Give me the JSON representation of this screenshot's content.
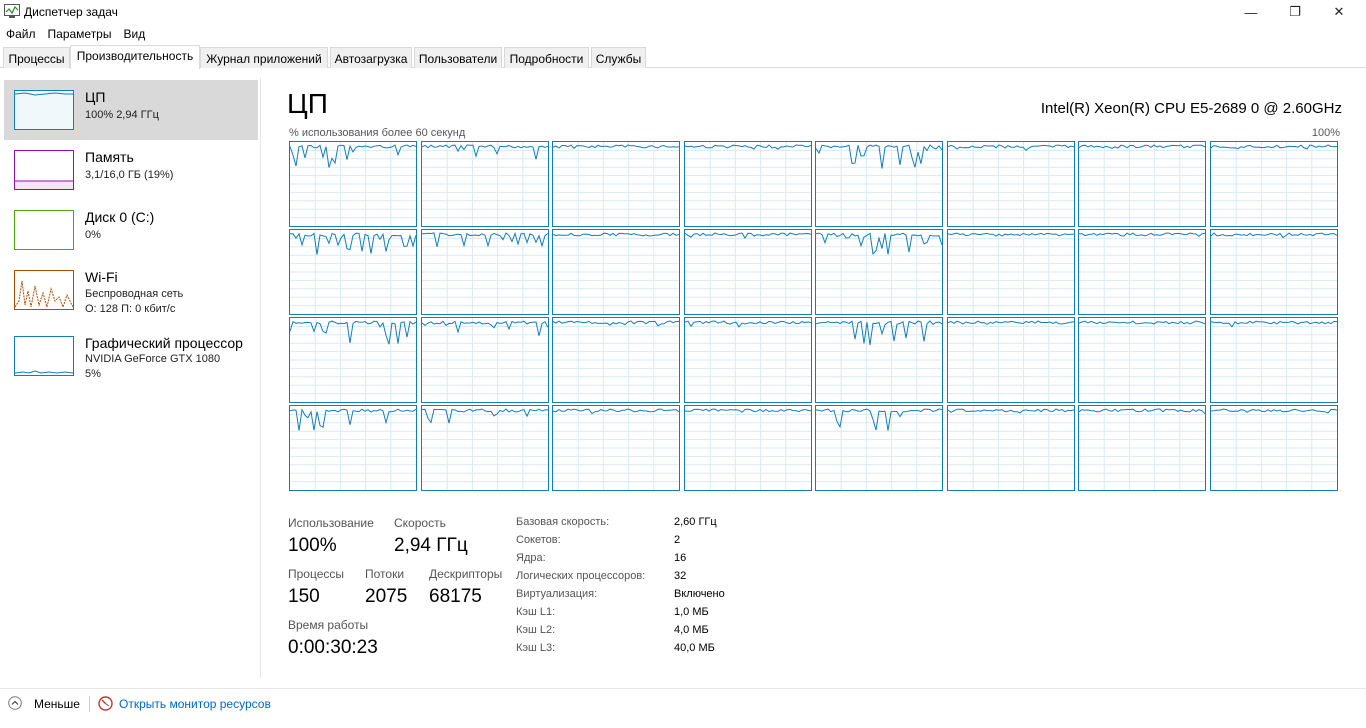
{
  "window": {
    "title": "Диспетчер задач",
    "minimize": "—",
    "restore": "❐",
    "close": "✕"
  },
  "menu": [
    "Файл",
    "Параметры",
    "Вид"
  ],
  "tabs": [
    "Процессы",
    "Производительность",
    "Журнал приложений",
    "Автозагрузка",
    "Пользователи",
    "Подробности",
    "Службы"
  ],
  "active_tab": 1,
  "sidebar": {
    "cpu": {
      "title": "ЦП",
      "sub": "100% 2,94 ГГц",
      "color": "#117dbb"
    },
    "memory": {
      "title": "Память",
      "sub": "3,1/16,0 ГБ (19%)",
      "color": "#8b12ae"
    },
    "disk": {
      "title": "Диск 0 (C:)",
      "sub": "0%",
      "color": "#4da60c"
    },
    "wifi": {
      "title": "Wi-Fi",
      "sub1": "Беспроводная сеть",
      "sub2": "О: 128 П: 0 кбит/с",
      "color": "#a74f01"
    },
    "gpu": {
      "title": "Графический процессор",
      "sub1": "NVIDIA GeForce GTX 1080",
      "sub2": "5%",
      "color": "#117dbb"
    }
  },
  "main": {
    "title": "ЦП",
    "cpu_name": "Intel(R) Xeon(R) CPU E5-2689 0 @ 2.60GHz",
    "caption_left": "% использования более 60 секунд",
    "caption_right": "100%",
    "graph_color": "#117dbb",
    "grid_color": "#d9eaf4",
    "core_rows": 4,
    "core_cols": 8
  },
  "stats": {
    "usage_label": "Использование",
    "usage_value": "100%",
    "speed_label": "Скорость",
    "speed_value": "2,94 ГГц",
    "processes_label": "Процессы",
    "processes_value": "150",
    "threads_label": "Потоки",
    "threads_value": "2075",
    "handles_label": "Дескрипторы",
    "handles_value": "68175",
    "uptime_label": "Время работы",
    "uptime_value": "0:00:30:23"
  },
  "details": [
    {
      "label": "Базовая скорость:",
      "value": "2,60 ГГц"
    },
    {
      "label": "Сокетов:",
      "value": "2"
    },
    {
      "label": "Ядра:",
      "value": "16"
    },
    {
      "label": "Логических процессоров:",
      "value": "32"
    },
    {
      "label": "Виртуализация:",
      "value": "Включено"
    },
    {
      "label": "Кэш L1:",
      "value": "1,0 МБ"
    },
    {
      "label": "Кэш L2:",
      "value": "4,0 МБ"
    },
    {
      "label": "Кэш L3:",
      "value": "40,0 МБ"
    }
  ],
  "footer": {
    "less": "Меньше",
    "monitor_link": "Открыть монитор ресурсов"
  }
}
